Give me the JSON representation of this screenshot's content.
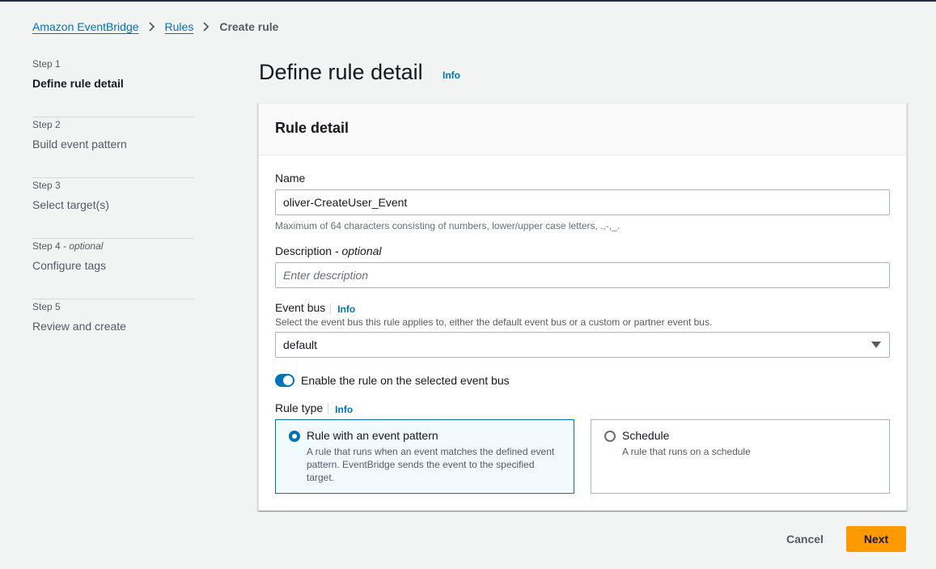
{
  "breadcrumb": {
    "items": [
      "Amazon EventBridge",
      "Rules"
    ],
    "current": "Create rule"
  },
  "steps": [
    {
      "num": "Step 1",
      "optional": "",
      "title": "Define rule detail",
      "active": true
    },
    {
      "num": "Step 2",
      "optional": "",
      "title": "Build event pattern",
      "active": false
    },
    {
      "num": "Step 3",
      "optional": "",
      "title": "Select target(s)",
      "active": false
    },
    {
      "num": "Step 4",
      "optional": " - optional",
      "title": "Configure tags",
      "active": false
    },
    {
      "num": "Step 5",
      "optional": "",
      "title": "Review and create",
      "active": false
    }
  ],
  "page": {
    "title": "Define rule detail",
    "info": "Info"
  },
  "rule_detail": {
    "header": "Rule detail",
    "name_label": "Name",
    "name_value": "oliver-CreateUser_Event",
    "name_hint": "Maximum of 64 characters consisting of numbers, lower/upper case letters, .,-,_.",
    "description_label": "Description",
    "description_optional": " - optional",
    "description_placeholder": "Enter description",
    "event_bus_label": "Event bus",
    "event_bus_info": "Info",
    "event_bus_hint": "Select the event bus this rule applies to, either the default event bus or a custom or partner event bus.",
    "event_bus_value": "default",
    "enable_label": "Enable the rule on the selected event bus",
    "enable_on": true,
    "rule_type_label": "Rule type",
    "rule_type_info": "Info",
    "rule_types": [
      {
        "title": "Rule with an event pattern",
        "desc": "A rule that runs when an event matches the defined event pattern. EventBridge sends the event to the specified target.",
        "selected": true
      },
      {
        "title": "Schedule",
        "desc": "A rule that runs on a schedule",
        "selected": false
      }
    ]
  },
  "actions": {
    "cancel": "Cancel",
    "next": "Next"
  },
  "colors": {
    "link": "#0073bb",
    "primary_button": "#ff9900",
    "selected_tile_bg": "#f1faff"
  }
}
